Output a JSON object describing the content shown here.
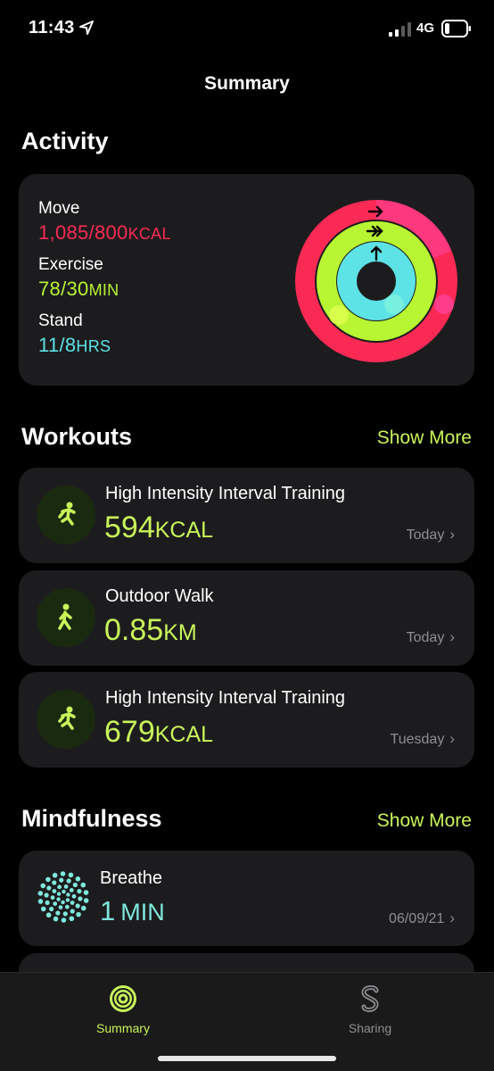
{
  "status_bar": {
    "time": "11:43",
    "network": "4G"
  },
  "nav": {
    "title": "Summary"
  },
  "activity": {
    "title": "Activity",
    "move": {
      "label": "Move",
      "value": "1,085/800",
      "unit": "KCAL",
      "color": "#fa2a55"
    },
    "exercise": {
      "label": "Exercise",
      "value": "78/30",
      "unit": "MIN",
      "color": "#b8f532"
    },
    "stand": {
      "label": "Stand",
      "value": "11/8",
      "unit": "HRS",
      "color": "#5de3e6"
    }
  },
  "workouts": {
    "title": "Workouts",
    "show_more": "Show More",
    "items": [
      {
        "name": "High Intensity Interval Training",
        "value": "594",
        "unit": "KCAL",
        "date": "Today",
        "icon": "hiit-figure-icon"
      },
      {
        "name": "Outdoor Walk",
        "value": "0.85",
        "unit": "KM",
        "date": "Today",
        "icon": "walk-figure-icon"
      },
      {
        "name": "High Intensity Interval Training",
        "value": "679",
        "unit": "KCAL",
        "date": "Tuesday",
        "icon": "hiit-figure-icon"
      }
    ]
  },
  "mindfulness": {
    "title": "Mindfulness",
    "show_more": "Show More",
    "items": [
      {
        "name": "Breathe",
        "value": "1",
        "unit": "MIN",
        "date": "06/09/21",
        "icon": "breathe-flower-icon"
      }
    ]
  },
  "tab_bar": {
    "tabs": [
      {
        "label": "Summary",
        "icon": "activity-rings-icon",
        "active": true
      },
      {
        "label": "Sharing",
        "icon": "sharing-icon",
        "active": false
      }
    ]
  },
  "colors": {
    "accent": "#c8f55a",
    "card": "#1c1c1e",
    "secondary_text": "#8e8e93"
  }
}
